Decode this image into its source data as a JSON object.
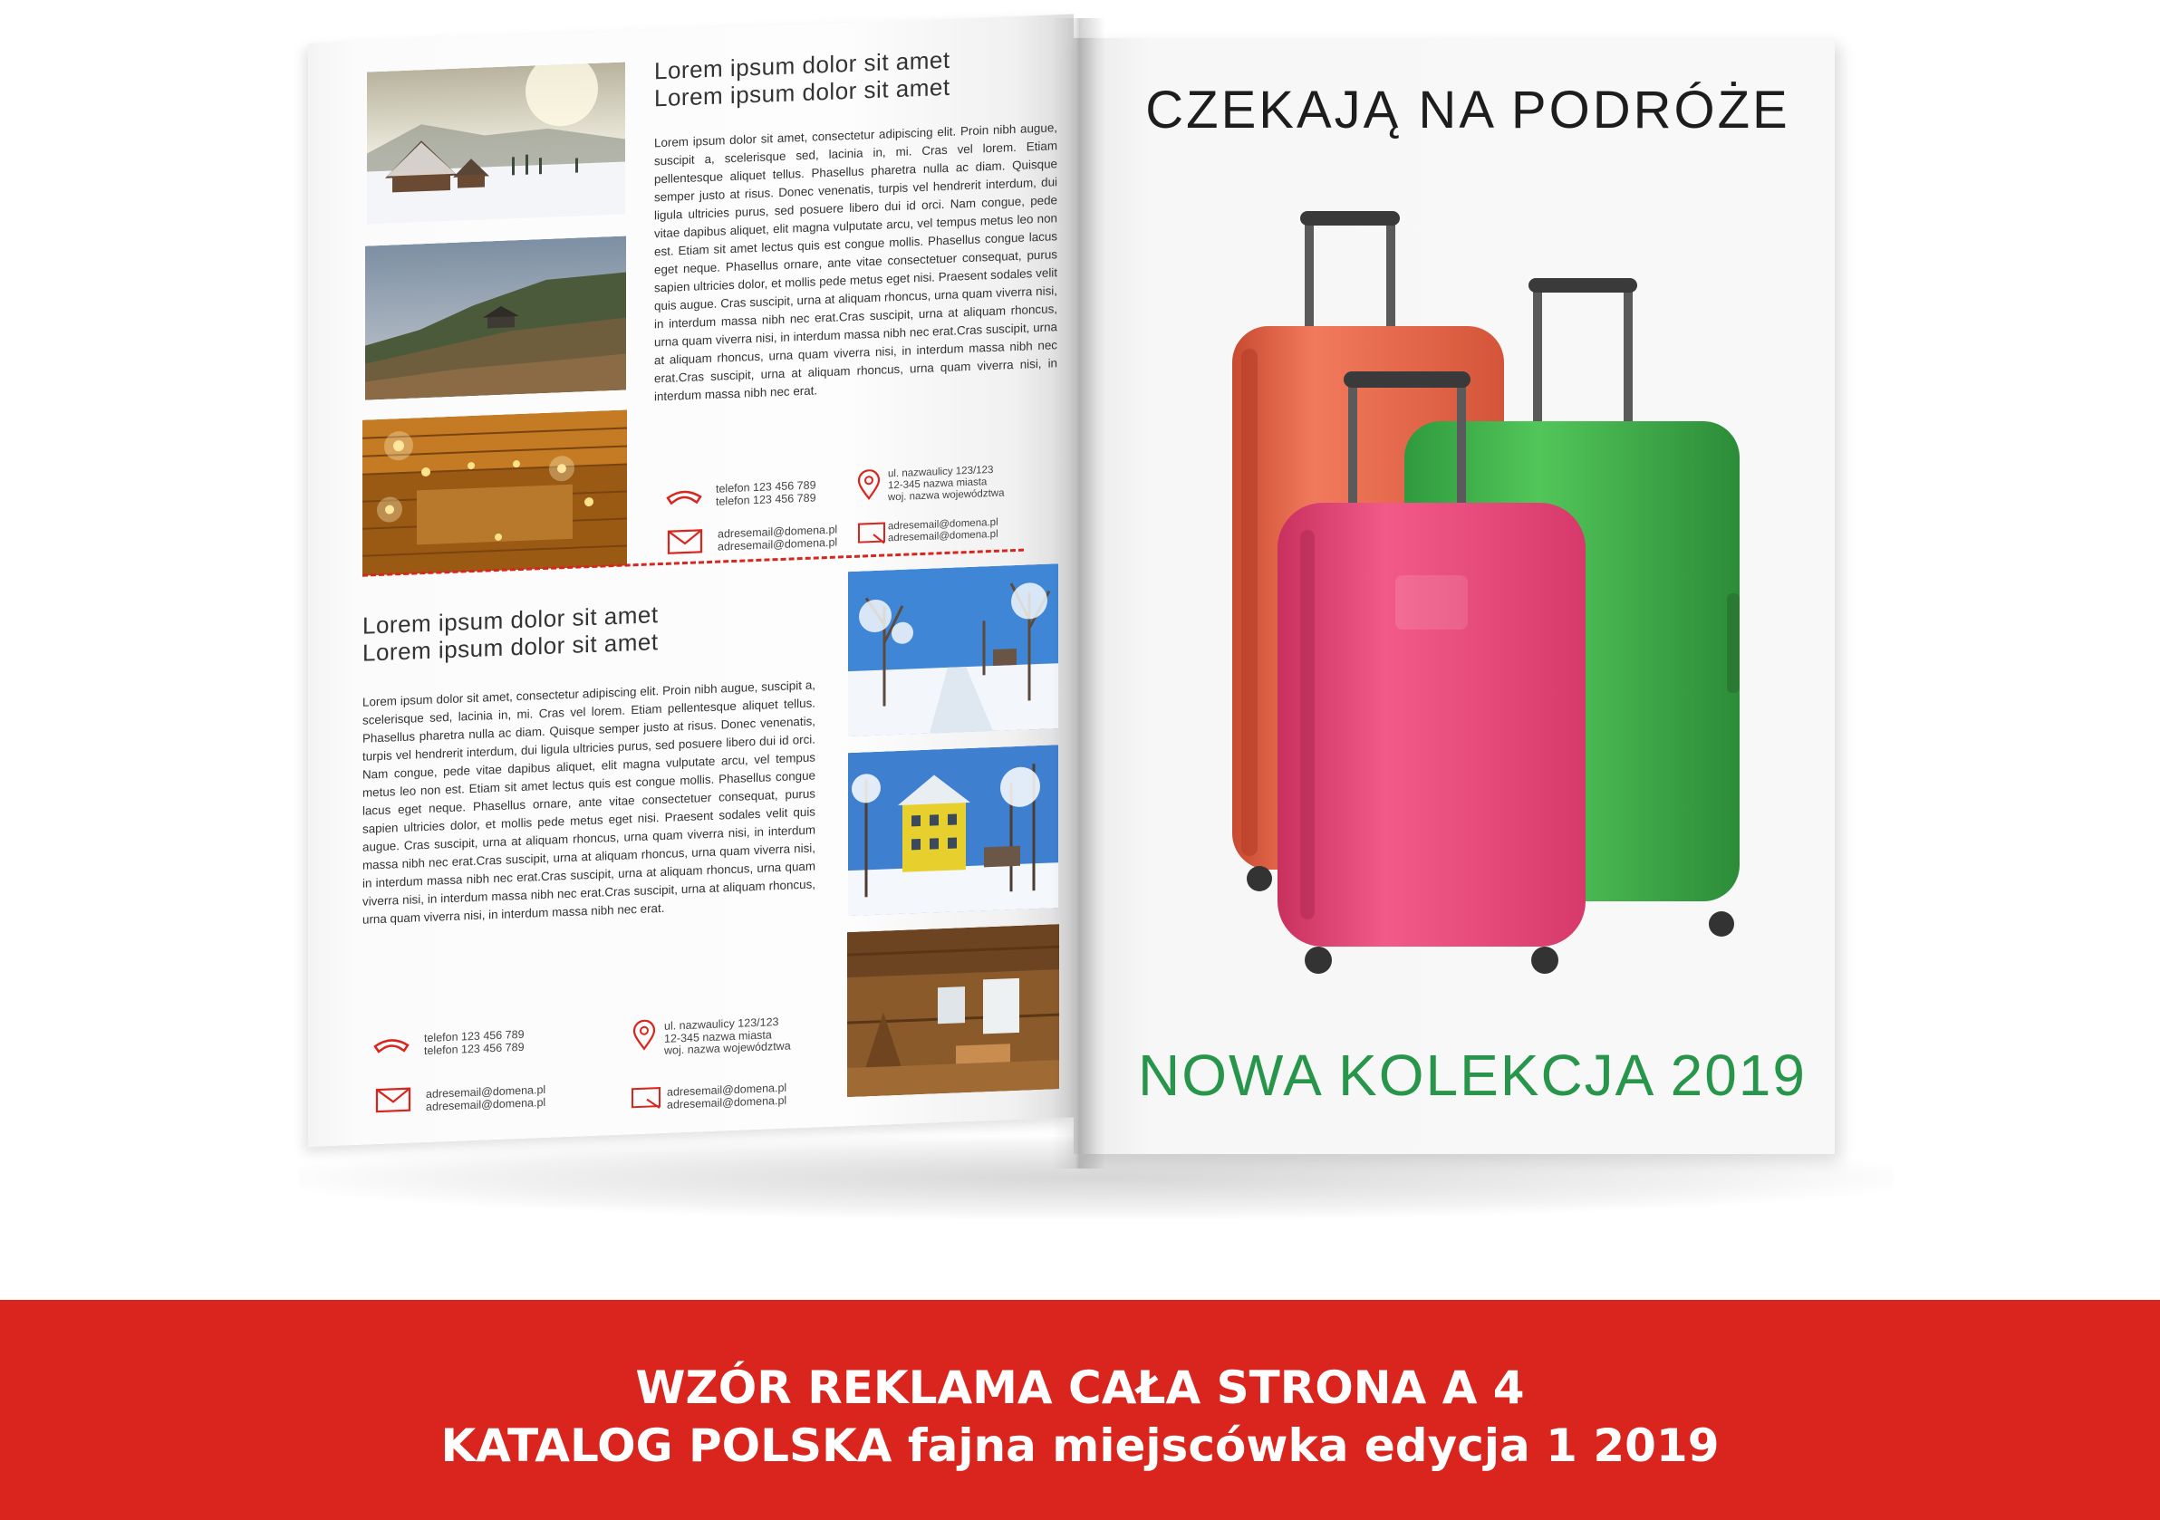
{
  "left_page": {
    "top_section": {
      "heading_line1": "Lorem ipsum dolor sit amet",
      "heading_line2": "Lorem ipsum dolor sit amet",
      "body": "Lorem ipsum dolor sit amet, consectetur adipiscing elit. Proin nibh augue, suscipit a, scelerisque sed, lacinia in, mi. Cras vel lorem. Etiam pellentesque aliquet tellus. Phasellus pharetra nulla ac diam. Quisque semper justo at risus. Donec venenatis, turpis vel hendrerit interdum, dui ligula ultricies purus, sed posuere libero dui id orci. Nam congue, pede vitae dapibus aliquet, elit magna vulputate arcu, vel tempus metus leo non est. Etiam sit amet lectus quis est congue mollis. Phasellus congue lacus eget neque. Phasellus ornare, ante vitae consectetuer consequat, purus sapien ultricies dolor, et mollis pede metus eget nisi. Praesent sodales velit quis augue. Cras suscipit, urna at aliquam rhoncus, urna quam viverra nisi, in interdum massa nibh nec erat.Cras suscipit, urna at aliquam rhoncus, urna quam viverra nisi, in interdum massa nibh nec erat.Cras suscipit, urna at aliquam rhoncus, urna quam viverra nisi, in interdum massa nibh nec erat.Cras suscipit, urna at aliquam rhoncus, urna quam viverra nisi, in interdum massa nibh nec erat.",
      "phone1": "telefon 123 456 789",
      "phone2": "telefon 123 456 789",
      "address1": "ul. nazwaulicy 123/123",
      "address2": "12-345 nazwa miasta",
      "address3": "woj. nazwa województwa",
      "email1": "adresemail@domena.pl",
      "email2": "adresemail@domena.pl",
      "email3": "adresemail@domena.pl",
      "email4": "adresemail@domena.pl"
    },
    "bottom_section": {
      "heading_line1": "Lorem ipsum dolor sit amet",
      "heading_line2": "Lorem ipsum dolor sit amet",
      "body": "Lorem ipsum dolor sit amet, consectetur adipiscing elit. Proin nibh augue, suscipit a, scelerisque sed, lacinia in, mi. Cras vel lorem. Etiam pellentesque aliquet tellus. Phasellus pharetra nulla ac diam. Quisque semper justo at risus. Donec venenatis, turpis vel hendrerit interdum, dui ligula ultricies purus, sed posuere libero dui id orci. Nam congue, pede vitae dapibus aliquet, elit magna vulputate arcu, vel tempus metus leo non est. Etiam sit amet lectus quis est congue mollis. Phasellus congue lacus eget neque. Phasellus ornare, ante vitae consectetuer consequat, purus sapien ultricies dolor, et mollis pede metus eget nisi. Praesent sodales velit quis augue. Cras suscipit, urna at aliquam rhoncus, urna quam viverra nisi, in interdum massa nibh nec erat.Cras suscipit, urna at aliquam rhoncus, urna quam viverra nisi, in interdum massa nibh nec erat.Cras suscipit, urna at aliquam rhoncus, urna quam viverra nisi, in interdum massa nibh nec erat.Cras suscipit, urna at aliquam rhoncus, urna quam viverra nisi, in interdum massa nibh nec erat.",
      "phone1": "telefon 123 456 789",
      "phone2": "telefon 123 456 789",
      "address1": "ul. nazwaulicy 123/123",
      "address2": "12-345 nazwa miasta",
      "address3": "woj. nazwa województwa",
      "email1": "adresemail@domena.pl",
      "email2": "adresemail@domena.pl",
      "email3": "adresemail@domena.pl",
      "email4": "adresemail@domena.pl"
    },
    "accent_color": "#d9251d"
  },
  "right_page": {
    "title": "CZEKAJĄ NA PODRÓŻE",
    "subtitle": "NOWA KOLEKCJA 2019",
    "subtitle_color": "#27964a",
    "suitcase_colors": [
      "#e8664a",
      "#3bb54a",
      "#e94a78"
    ]
  },
  "banner": {
    "line1": "WZÓR REKLAMA CAŁA STRONA  A 4",
    "line2": "KATALOG POLSKA fajna miejscówka edycja 1 2019",
    "background": "#d9251d"
  }
}
